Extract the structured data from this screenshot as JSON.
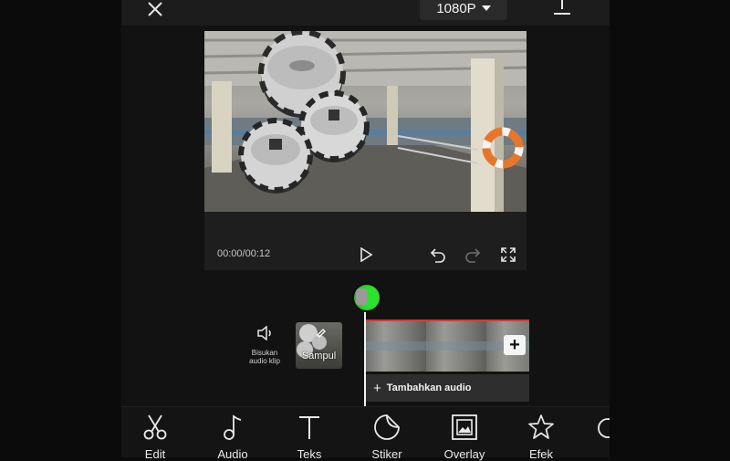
{
  "topbar": {
    "resolution_label": "1080P"
  },
  "preview": {
    "timecode": "00:00/00:12"
  },
  "timeline": {
    "mute_label_line1": "Bisukan",
    "mute_label_line2": "audio klip",
    "cover_label": "Sampul",
    "add_audio_label": "Tambahkan audio"
  },
  "toolbar": {
    "items": [
      {
        "label": "Edit",
        "icon": "scissors-icon"
      },
      {
        "label": "Audio",
        "icon": "music-note-icon"
      },
      {
        "label": "Teks",
        "icon": "text-icon"
      },
      {
        "label": "Stiker",
        "icon": "sticker-icon"
      },
      {
        "label": "Overlay",
        "icon": "overlay-icon"
      },
      {
        "label": "Efek",
        "icon": "star-icon"
      }
    ]
  },
  "colors": {
    "accent_green": "#2ee02e",
    "clip_border": "#d23a3a"
  }
}
